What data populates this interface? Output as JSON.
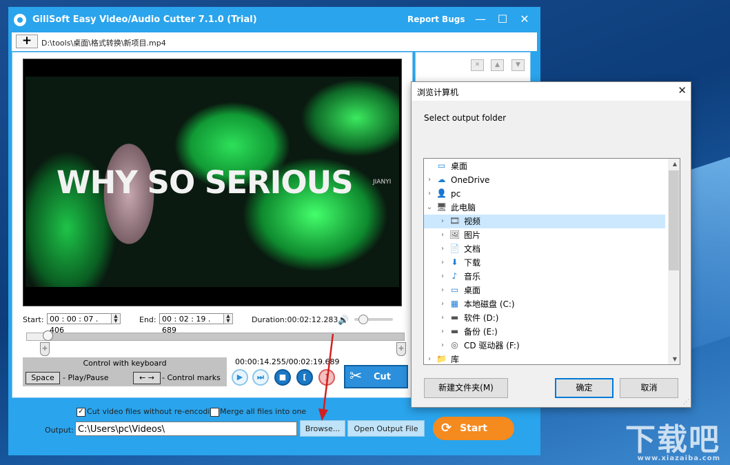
{
  "window": {
    "title": "GiliSoft Easy Video/Audio Cutter 7.1.0 (Trial)",
    "report_bugs": "Report Bugs",
    "minimize": "—",
    "maximize": "☐",
    "close": "✕"
  },
  "file": {
    "add_label": "+",
    "path": "D:\\tools\\桌面\\格式转换\\新项目.mp4"
  },
  "video": {
    "overlay_text": "WHY SO SERIOUS",
    "overlay_small": "JIANYI"
  },
  "timing": {
    "start_label": "Start:",
    "start_value": "00 : 00 : 07 . 406",
    "end_label": "End:",
    "end_value": "00 : 02 : 19 . 689",
    "duration_label": "Duration:",
    "duration_value": "00:02:12.283",
    "current_time": "00:00:14.255/00:02:19.689",
    "volume_level": 0.1,
    "seek_position": 0.055
  },
  "keyboard": {
    "title": "Control with keyboard",
    "space_key": "Space",
    "space_desc": "- Play/Pause",
    "arrow_keys": "← →",
    "arrow_desc": "- Control marks"
  },
  "cut_button": "Cut",
  "options": {
    "no_reencode_label": "Cut video files without re-encoding",
    "no_reencode_checked": true,
    "merge_label": "Merge all files into one",
    "merge_checked": false
  },
  "output": {
    "label": "Output:",
    "value": "C:\\Users\\pc\\Videos\\",
    "browse": "Browse...",
    "open_output": "Open Output File",
    "start": "Start"
  },
  "dialog": {
    "title": "浏览计算机",
    "prompt": "Select output folder",
    "tree": [
      {
        "label": "桌面",
        "icon": "desktop-icon",
        "level": 0,
        "expand": ""
      },
      {
        "label": "OneDrive",
        "icon": "cloud-icon",
        "level": 0,
        "expand": ">"
      },
      {
        "label": "pc",
        "icon": "user-icon",
        "level": 0,
        "expand": ">"
      },
      {
        "label": "此电脑",
        "icon": "computer-icon",
        "level": 0,
        "expand": "v"
      },
      {
        "label": "视频",
        "icon": "video-folder-icon",
        "level": 1,
        "expand": ">",
        "selected": true
      },
      {
        "label": "图片",
        "icon": "pictures-folder-icon",
        "level": 1,
        "expand": ">"
      },
      {
        "label": "文档",
        "icon": "documents-folder-icon",
        "level": 1,
        "expand": ">"
      },
      {
        "label": "下载",
        "icon": "download-folder-icon",
        "level": 1,
        "expand": ">"
      },
      {
        "label": "音乐",
        "icon": "music-folder-icon",
        "level": 1,
        "expand": ">"
      },
      {
        "label": "桌面",
        "icon": "desktop-icon",
        "level": 1,
        "expand": ">"
      },
      {
        "label": "本地磁盘 (C:)",
        "icon": "windows-drive-icon",
        "level": 1,
        "expand": ">"
      },
      {
        "label": "软件 (D:)",
        "icon": "drive-icon",
        "level": 1,
        "expand": ">"
      },
      {
        "label": "备份 (E:)",
        "icon": "drive-icon",
        "level": 1,
        "expand": ">"
      },
      {
        "label": "CD 驱动器 (F:)",
        "icon": "cd-drive-icon",
        "level": 1,
        "expand": ">"
      },
      {
        "label": "库",
        "icon": "library-icon",
        "level": 0,
        "expand": ">"
      }
    ],
    "new_folder": "新建文件夹(M)",
    "ok": "确定",
    "cancel": "取消"
  },
  "watermark": {
    "main": "下载吧",
    "sub": "www.xiazaiba.com"
  }
}
